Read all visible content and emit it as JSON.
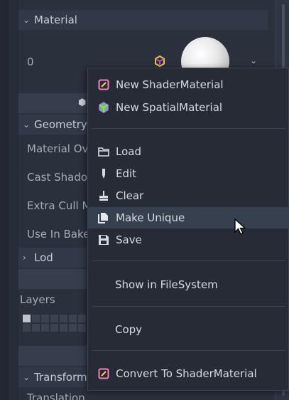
{
  "inspector": {
    "material_section": "Material",
    "material_slot": "0",
    "geometry_section": "Geometry",
    "rows": [
      "Material Override",
      "Cast Shadow",
      "Extra Cull Margin",
      "Use In Baked Light"
    ],
    "lod_section": "Lod",
    "layers_label": "Layers",
    "transform_section": "Transform",
    "translation_label": "Translation"
  },
  "menu": {
    "new_shader": "New ShaderMaterial",
    "new_spatial": "New SpatialMaterial",
    "load": "Load",
    "edit": "Edit",
    "clear": "Clear",
    "make_unique": "Make Unique",
    "save": "Save",
    "show_fs": "Show in FileSystem",
    "copy": "Copy",
    "convert": "Convert To ShaderMaterial"
  },
  "colors": {
    "shader_icon": "#f77fbe",
    "spatial_icon": "#c06ef8",
    "highlight": "#36404f"
  }
}
